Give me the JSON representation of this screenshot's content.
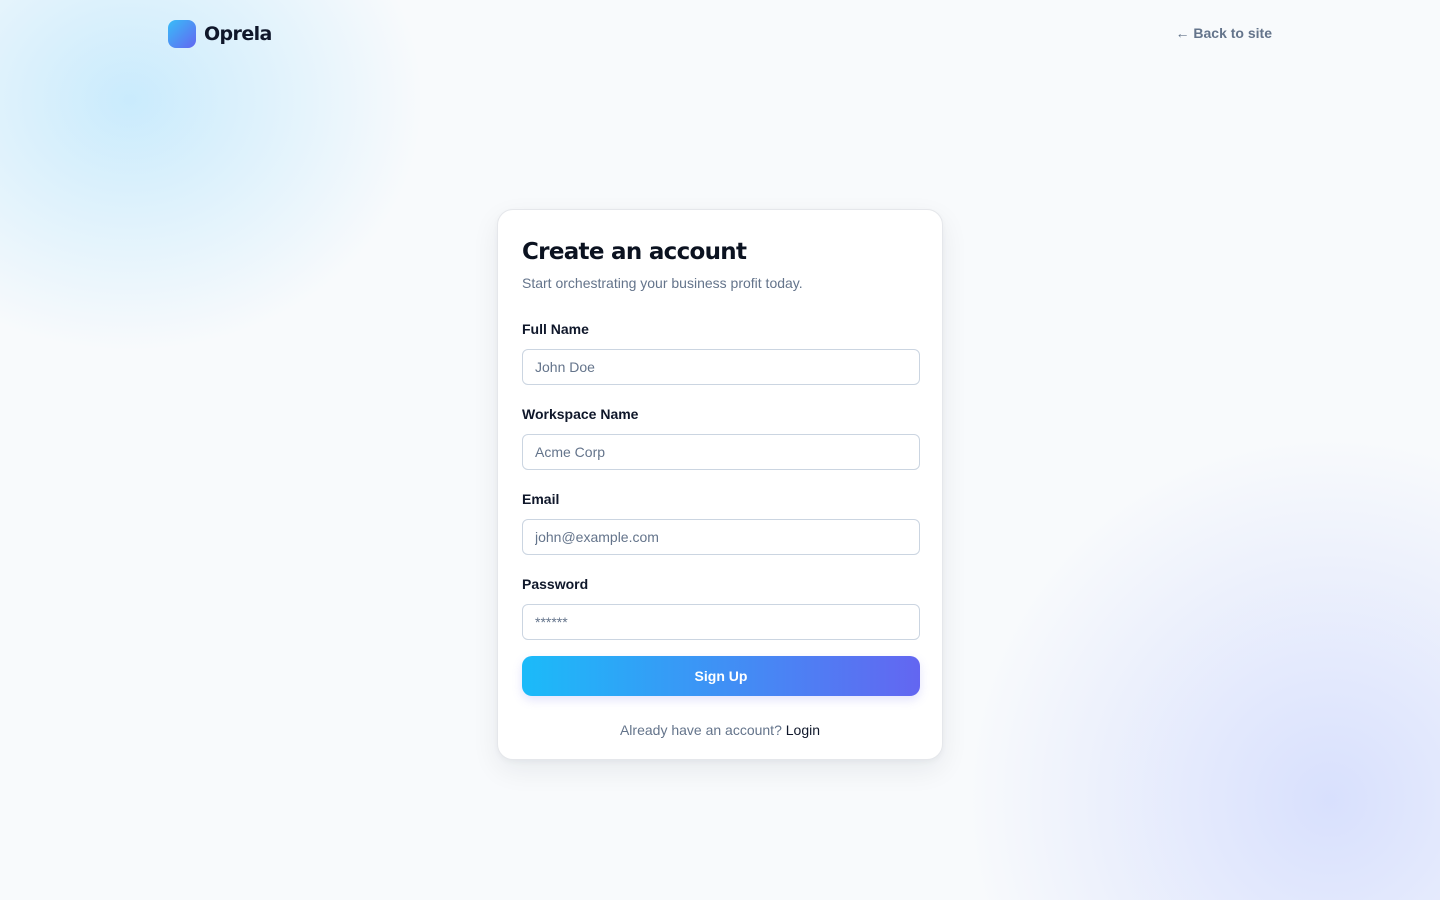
{
  "header": {
    "brand": "Oprela",
    "back_link": "← Back to site"
  },
  "form": {
    "title": "Create an account",
    "subtitle": "Start orchestrating your business profit today.",
    "fields": [
      {
        "label": "Full Name",
        "placeholder": "John Doe",
        "type": "text",
        "value": ""
      },
      {
        "label": "Workspace Name",
        "placeholder": "Acme Corp",
        "type": "text",
        "value": ""
      },
      {
        "label": "Email",
        "placeholder": "john@example.com",
        "type": "email",
        "value": ""
      },
      {
        "label": "Password",
        "placeholder": "******",
        "type": "password",
        "value": ""
      }
    ],
    "submit_label": "Sign Up",
    "login_prompt": "Already have an account?",
    "login_link": "Login"
  },
  "icons": {
    "brand_logo": "gradient-rounded-square"
  },
  "colors": {
    "accent_start": "#1bbbf9",
    "accent_end": "#6366f1",
    "muted_text": "#64748b",
    "heading_text": "#0b1220"
  }
}
